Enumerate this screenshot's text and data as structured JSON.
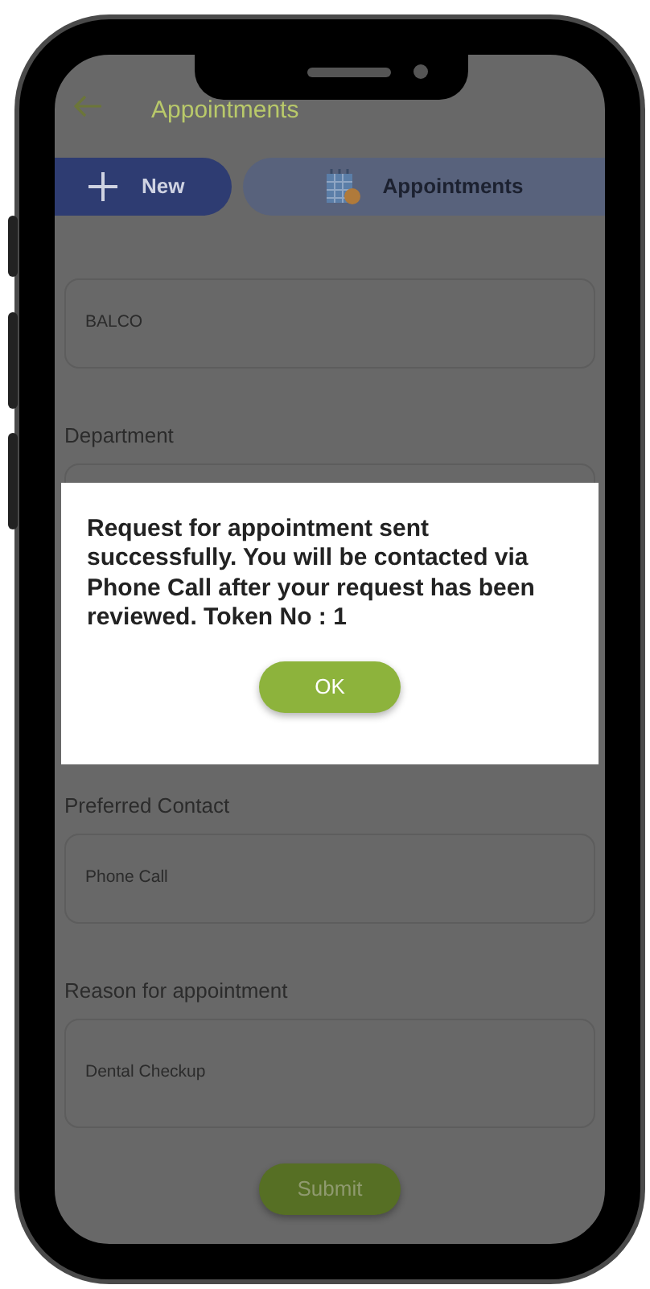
{
  "header": {
    "title": "Appointments"
  },
  "tabs": [
    {
      "label": "New",
      "kind": "new",
      "selected": true
    },
    {
      "label": "Appointments",
      "kind": "list",
      "selected": false
    }
  ],
  "form": [
    {
      "value": "BALCO"
    },
    {
      "label": "Department"
    },
    {
      "label": "Preferred Contact",
      "value": "Phone Call"
    },
    {
      "label": "Reason for appointment",
      "value": "Dental Checkup",
      "kind": "tall"
    }
  ],
  "submit": "Submit",
  "dialog": {
    "message": "Request for appointment sent successfully. You will be contacted via Phone Call after your request has been reviewed. Token No : 1",
    "button": "OK"
  }
}
